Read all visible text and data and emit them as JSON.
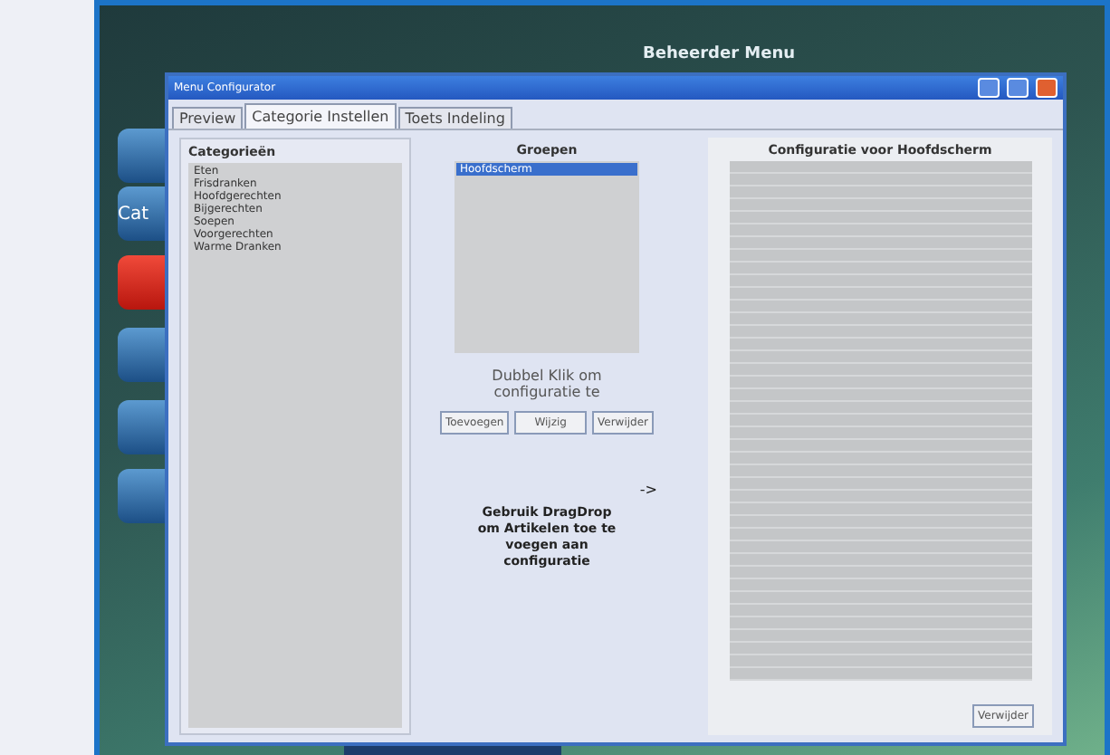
{
  "background_app": {
    "title": "Beheerder Menu",
    "side_button_label": "Cat"
  },
  "window": {
    "title": "Menu Configurator"
  },
  "tabs": [
    {
      "label": "Preview",
      "selected": false
    },
    {
      "label": "Categorie Instellen",
      "selected": true
    },
    {
      "label": "Toets Indeling",
      "selected": false
    }
  ],
  "categories": {
    "heading": "Categorieën",
    "items": [
      {
        "label": "Eten",
        "selected": false
      },
      {
        "label": "Frisdranken",
        "selected": false
      },
      {
        "label": "Hoofdgerechten",
        "selected": false
      },
      {
        "label": "Bijgerechten",
        "selected": false
      },
      {
        "label": "Soepen",
        "selected": false
      },
      {
        "label": "Voorgerechten",
        "selected": false
      },
      {
        "label": "Warme Dranken",
        "selected": false
      }
    ]
  },
  "groups": {
    "heading": "Groepen",
    "items": [
      {
        "label": "Hoofdscherm",
        "selected": true
      }
    ]
  },
  "hint": "Dubbel Klik om configuratie te",
  "group_buttons": [
    "Toevoegen",
    "Wijzig",
    "Verwijder"
  ],
  "arrow": "->",
  "dragdrop_hint": "Gebruik DragDrop om Artikelen toe te voegen aan configuratie",
  "configuration": {
    "heading": "Configuratie voor Hoofdscherm",
    "button": "Verwijder"
  }
}
